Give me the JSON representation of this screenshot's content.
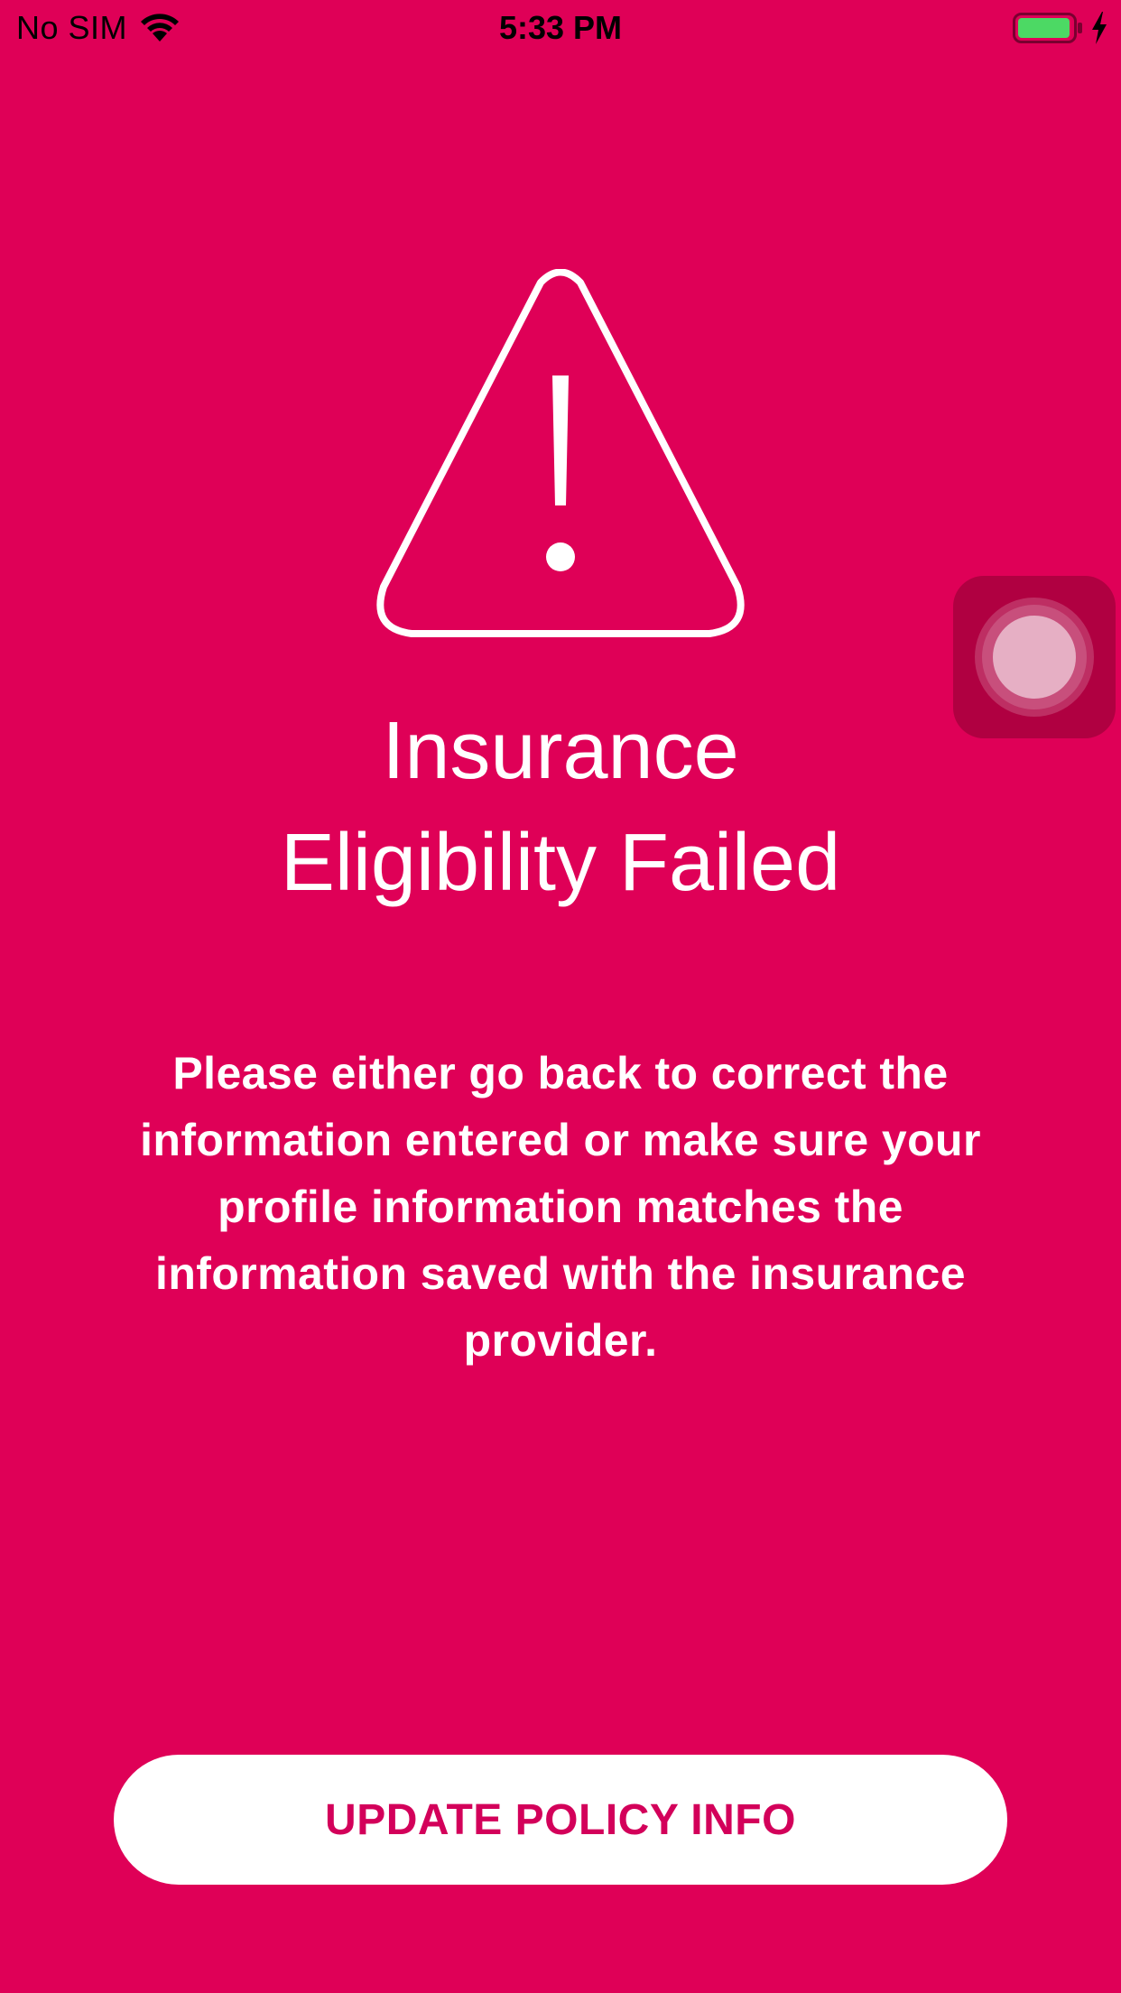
{
  "theme": {
    "background": "#DF0057",
    "button_bg": "#FFFFFF",
    "button_text": "#D3005A",
    "battery_fill": "#4CD964"
  },
  "status_bar": {
    "carrier": "No SIM",
    "time": "5:33 PM",
    "wifi_icon": "wifi-icon",
    "battery_icon": "battery-charging-icon",
    "charging_icon": "lightning-bolt-icon"
  },
  "icon": {
    "name": "warning-triangle-icon"
  },
  "title": {
    "line1": "Insurance",
    "line2": "Eligibility Failed"
  },
  "message": "Please either go back to correct the information entered or make sure your profile information matches the information saved with the insurance provider.",
  "button": {
    "label": "UPDATE POLICY INFO"
  },
  "assistive_touch": {
    "icon": "assistive-touch-icon"
  }
}
